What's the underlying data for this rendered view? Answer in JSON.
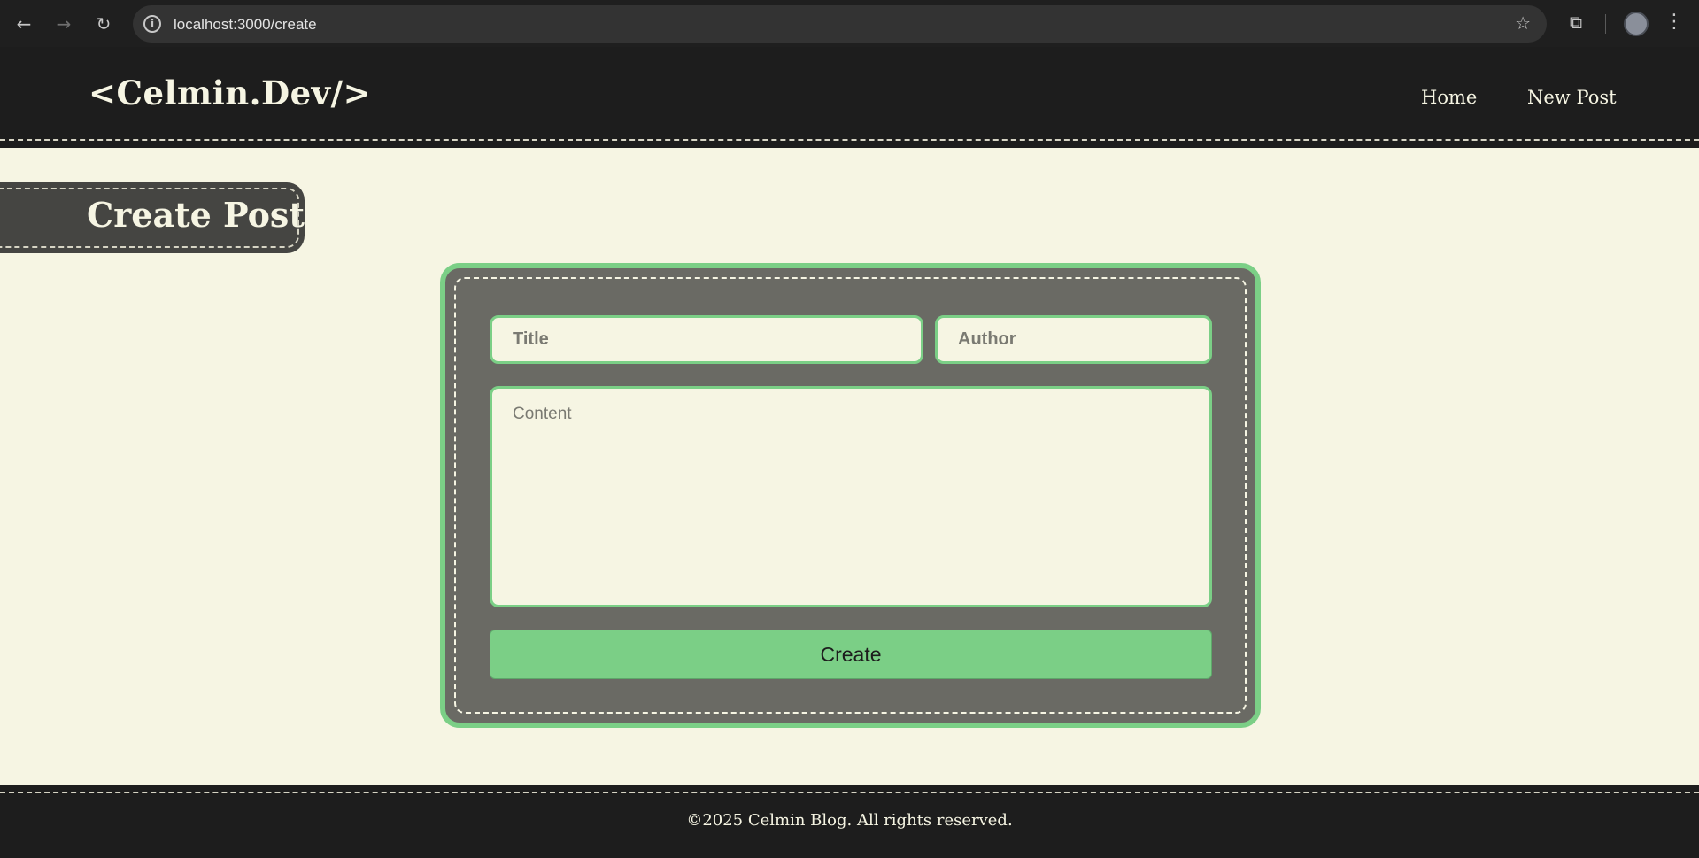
{
  "browser": {
    "back_icon": "←",
    "forward_icon": "→",
    "reload_icon": "↻",
    "url": "localhost:3000/create",
    "info_icon": "i",
    "star_icon": "☆",
    "extensions_icon": "⧉",
    "menu_icon": "⋮"
  },
  "header": {
    "logo": "<Celmin.Dev/>",
    "nav": {
      "home": "Home",
      "new_post": "New Post"
    }
  },
  "page": {
    "heading": "Create Post"
  },
  "form": {
    "title_placeholder": "Title",
    "title_value": "",
    "author_placeholder": "Author",
    "author_value": "",
    "content_placeholder": "Content",
    "content_value": "",
    "submit_label": "Create"
  },
  "footer": {
    "copyright": "©2025 Celmin Blog. All rights reserved."
  },
  "colors": {
    "background": "#f6f5e3",
    "header_bg": "#1d1d1d",
    "accent_green": "#7bcf86",
    "card_bg": "#6a6a64"
  }
}
